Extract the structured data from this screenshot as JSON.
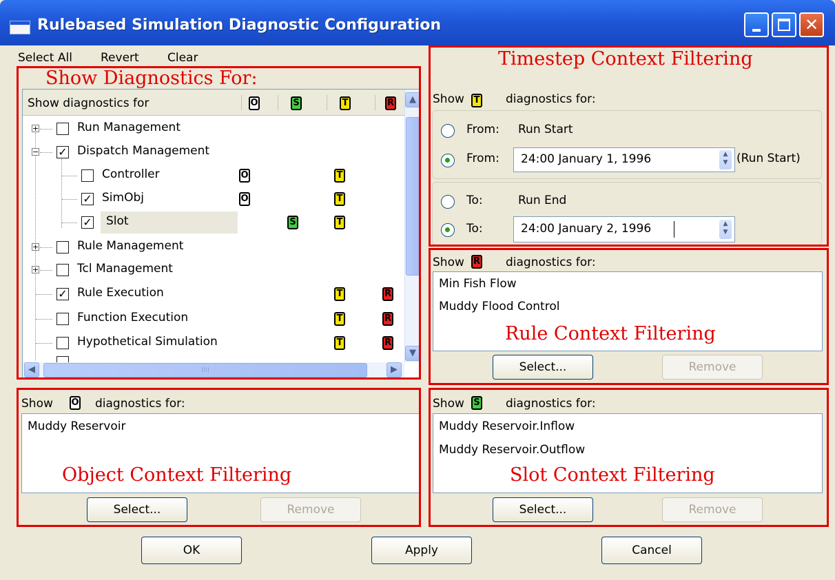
{
  "window": {
    "title": "Rulebased Simulation Diagnostic Configuration",
    "close_glyph": "✕"
  },
  "menu": {
    "select_all": "Select All",
    "revert": "Revert",
    "clear": "Clear"
  },
  "annotations": {
    "show_diagnostics_for": "Show Diagnostics For:",
    "timestep": "Timestep Context Filtering",
    "rule": "Rule Context Filtering",
    "object": "Object Context Filtering",
    "slot": "Slot Context Filtering"
  },
  "tree": {
    "header": "Show diagnostics for",
    "col_badges": [
      "O",
      "S",
      "T",
      "R"
    ],
    "rows": [
      {
        "label": "Run Management",
        "checked": "",
        "expander": "+"
      },
      {
        "label": "Dispatch Management",
        "checked": "✓",
        "expander": "−"
      },
      {
        "label": "Controller",
        "checked": "",
        "badges": [
          "O",
          "T"
        ]
      },
      {
        "label": "SimObj",
        "checked": "✓",
        "badges": [
          "O",
          "T"
        ]
      },
      {
        "label": "Slot",
        "checked": "✓",
        "badges": [
          "S",
          "T"
        ]
      },
      {
        "label": "Rule Management",
        "checked": "",
        "expander": "+"
      },
      {
        "label": "Tcl Management",
        "checked": "",
        "expander": "+"
      },
      {
        "label": "Rule Execution",
        "checked": "✓",
        "badges": [
          "T",
          "R"
        ]
      },
      {
        "label": "Function Execution",
        "checked": "",
        "badges": [
          "T",
          "R"
        ]
      },
      {
        "label": "Hypothetical Simulation",
        "checked": "",
        "badges": [
          "T",
          "R"
        ]
      }
    ],
    "hscroll_grip": "IIII"
  },
  "timestep": {
    "show": "Show",
    "badge": "T",
    "diag_for": "diagnostics for:",
    "from_label": "From:",
    "from_default": "Run Start",
    "from_value": "24:00 January 1, 1996",
    "from_hint": "(Run Start)",
    "to_label": "To:",
    "to_default": "Run End",
    "to_value": "24:00 January 2, 1996"
  },
  "rule_filter": {
    "show": "Show",
    "badge": "R",
    "diag_for": "diagnostics for:",
    "items": [
      "Min Fish Flow",
      "Muddy Flood Control"
    ],
    "select": "Select...",
    "remove": "Remove"
  },
  "object_filter": {
    "show": "Show",
    "badge": "O",
    "diag_for": "diagnostics for:",
    "items": [
      "Muddy Reservoir"
    ],
    "select": "Select...",
    "remove": "Remove"
  },
  "slot_filter": {
    "show": "Show",
    "badge": "S",
    "diag_for": "diagnostics for:",
    "items": [
      "Muddy Reservoir.Inflow",
      "Muddy Reservoir.Outflow"
    ],
    "select": "Select...",
    "remove": "Remove"
  },
  "footer": {
    "ok": "OK",
    "apply": "Apply",
    "cancel": "Cancel"
  }
}
